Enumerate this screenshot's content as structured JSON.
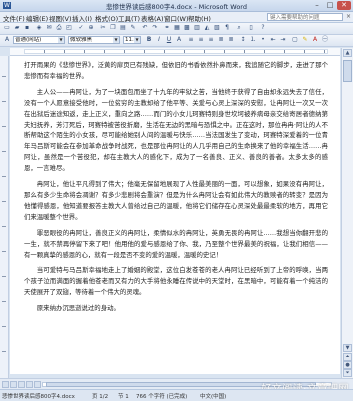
{
  "window": {
    "title": "悲惨世界读后感800字4.docx - Microsoft Word",
    "controls": {
      "minimize": "–",
      "maximize": "□",
      "close": "✕"
    }
  },
  "menubar": {
    "items": [
      "文件(F)",
      "编辑(E)",
      "视图(V)",
      "插入(I)",
      "格式(O)",
      "工具(T)",
      "表格(A)",
      "窗口(W)",
      "帮助(H)"
    ],
    "help_placeholder": "键入需要帮助的问题",
    "close": "×"
  },
  "toolbar": {
    "style_value": "普通(网站)",
    "font_value": "微软雅黑",
    "size_value": "11.5"
  },
  "document": {
    "paragraphs": [
      "打开雨果的《悲惨世界》，泛黄的扉页已有残缺，但依旧的书香依然扑鼻而来，我追随它的脚步，走进了那个悲惨而有幸福的世界。",
      "主人公——冉阿让，为了一块面包而坐了十九年的牢狱之苦，当他终于获得了自由却永远失去了信任，没有一个人愿意接受他时，一位贫穷的主教却给了他平等、关爱与心灵上深深的安慰，让冉阿让一次又一次在出狱后迷途知返，走上正义，重向之路……而门的小女儿珂赛特则身世坎坷被养病母亲交给寄居者德纳第夫妇抚养，芳汀死后，珂赛特被苦役折磨，生活在无边的黑暗与恐惧之中。正在这时，那位冉冉·阿让的人不断帮助这个陌生的小女孩，尽可能给她别人间的温暖与快乐……当法国发生了变动，珂赛特深爱着的一位青年马吕斯可能会在参加革命战争时战死，也是那位冉阿让的人几乎用自己的生命换来了他的幸福生活……冉阿让，虽然是一个苦役犯，却在主教大人的感化下，成为了一名善良、正义、善良的善者。太多太多的感恩，一言难尽。",
      "冉阿让，他让平凡得到了伟大；他毫无保留地展现了人性最美丽的一面，可以想象，如果没有冉阿让，那么有多少生命将会凋谢？有多少悲剧将会重演？但是为什么冉阿让会有如此伟大的教赎者的转变？是因为他懂得感恩，他知道要报答主教大人曾给过自己的温暖，他将它们储存在心灵深处最最柔软的地方，再用它们来温暖整个世界。",
      "罪恶眼役的冉阿让，善良正义的冉阿让，柔情似水的冉阿让，英勇无畏的冉阿让……我想当你翻开悲的一生，就不禁再停留下来了吧！他用他的爱与感恩给了你、我，乃至整个世界最美的祝福，让我们相信——有一颗真挚的感恩的心，就有一段是否不变的爱的温暖，温暖的史记！",
      "当可爱特与马吕斯幸福地走上了婚姻的殿堂，这位白发苍苍的老人冉阿让已经听到了上帝的呼唤，当两个孩子泣而满面的握着他苍老而又有力的大手将他永睡在传说中的天堂时，在黑暗中，可能有着一个纯洁的天使展开了双翅，等待着一个伟大的灵魂。",
      "原来纳办沉思逝说过的身动。"
    ]
  },
  "statusbar": {
    "segments": [
      "悲惨世界读后感800字4.docx",
      "页 1/2",
      "节 1",
      "766 个字符 (已完成)",
      "中文(中国)"
    ]
  },
  "watermark": "好文阅读·文章吧网"
}
